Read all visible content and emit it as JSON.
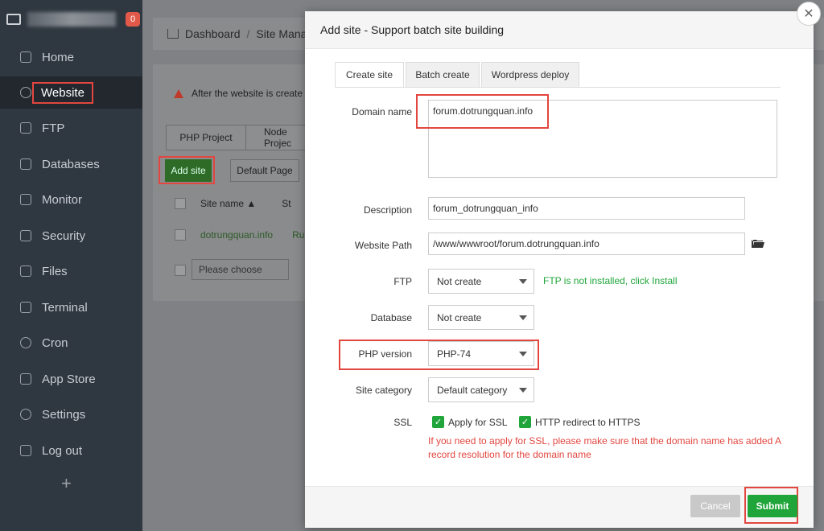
{
  "sidebar": {
    "notification_count": "0",
    "items": [
      {
        "label": "Home",
        "icon": "home-icon"
      },
      {
        "label": "Website",
        "icon": "globe-icon"
      },
      {
        "label": "FTP",
        "icon": "ftp-icon"
      },
      {
        "label": "Databases",
        "icon": "database-icon"
      },
      {
        "label": "Monitor",
        "icon": "monitor-icon"
      },
      {
        "label": "Security",
        "icon": "shield-icon"
      },
      {
        "label": "Files",
        "icon": "folder-icon"
      },
      {
        "label": "Terminal",
        "icon": "terminal-icon"
      },
      {
        "label": "Cron",
        "icon": "clock-icon"
      },
      {
        "label": "App Store",
        "icon": "grid-icon"
      },
      {
        "label": "Settings",
        "icon": "gear-icon"
      },
      {
        "label": "Log out",
        "icon": "logout-icon"
      }
    ],
    "add_label": "+"
  },
  "background": {
    "breadcrumb_home": "Dashboard",
    "breadcrumb_current": "Site Mana",
    "warning_text": "After the website is create",
    "tab_php": "PHP Project",
    "tab_node": "Node Projec",
    "add_site": "Add site",
    "default_page": "Default Page",
    "col_site_name": "Site name ▲",
    "col_status": "St",
    "row_site": "dotrungquan.info",
    "row_status": "Ru",
    "choose_placeholder": "Please choose"
  },
  "modal": {
    "title": "Add site - Support batch site building",
    "tabs": [
      "Create site",
      "Batch create",
      "Wordpress deploy"
    ],
    "domain_label": "Domain name",
    "domain_value": "forum.dotrungquan.info",
    "description_label": "Description",
    "description_value": "forum_dotrungquan_info",
    "path_label": "Website Path",
    "path_value": "/www/wwwroot/forum.dotrungquan.info",
    "ftp_label": "FTP",
    "ftp_value": "Not create",
    "ftp_note": "FTP is not installed, click Install",
    "database_label": "Database",
    "database_value": "Not create",
    "php_label": "PHP version",
    "php_value": "PHP-74",
    "category_label": "Site category",
    "category_value": "Default category",
    "ssl_label": "SSL",
    "ssl_apply": "Apply for SSL",
    "ssl_redirect": "HTTP redirect to HTTPS",
    "ssl_note": "If you need to apply for SSL, please make sure that the domain name has added A record resolution for the domain name",
    "cancel": "Cancel",
    "submit": "Submit"
  },
  "colors": {
    "accent_green": "#20a53a",
    "highlight_red": "#e2463f",
    "sidebar_bg": "#2f3740"
  }
}
